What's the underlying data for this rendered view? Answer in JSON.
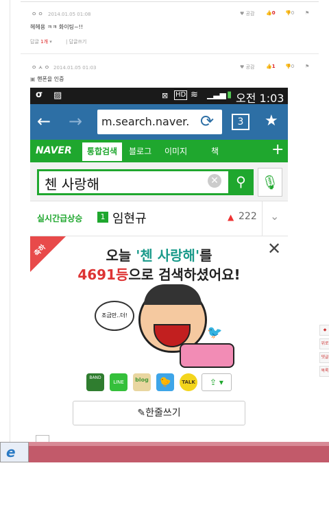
{
  "comment1": {
    "author": "ㅇㅇ",
    "date": "2014.01.05 01:08",
    "text": "헤헤용 ㅋㅋ 화이팅~!!",
    "like_label": "공감",
    "like_count": "0",
    "dislike_count": "0",
    "reply_label": "답글",
    "reply_count": "1개",
    "write_reply": "답글쓰기"
  },
  "comment2": {
    "author": "ㅇㅅㅇ",
    "date": "2014.01.05 01:03",
    "text": "핸폰을 인증",
    "like_label": "공감",
    "like_count": "1",
    "dislike_count": "0"
  },
  "phone": {
    "time": "오전 1:03",
    "url": "m.search.naver.",
    "tab_count": "3",
    "nav_tabs": [
      "NAVER",
      "통합검색",
      "블로그",
      "이미지",
      "책"
    ],
    "search_value": "첸 사랑해",
    "realtime_label": "실시간급상승",
    "realtime_rank": "1",
    "realtime_name": "임현규",
    "realtime_count": "222",
    "ribbon": "축하",
    "headline1_pre": "오늘 ",
    "headline1_quote": "'첸 사랑해'",
    "headline1_post": "를",
    "headline2_num": "4691등",
    "headline2_post": "으로 검색하셨어요!",
    "speech": "조금만..더!",
    "share_labels": [
      "BAND",
      "LINE",
      "blog",
      "",
      "TALK"
    ],
    "write_button": "한줄쓰기"
  },
  "side": [
    "위로",
    "댓글",
    "목록"
  ]
}
